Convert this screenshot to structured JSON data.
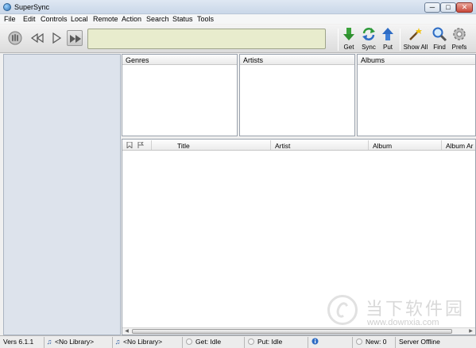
{
  "window": {
    "title": "SuperSync",
    "minimize_glyph": "─",
    "maximize_glyph": "□",
    "close_glyph": "✕"
  },
  "menu": [
    "File",
    "Edit",
    "Controls",
    "Local",
    "Remote",
    "Action",
    "Search",
    "Status",
    "Tools"
  ],
  "toolbar": {
    "get_label": "Get",
    "sync_label": "Sync",
    "put_label": "Put",
    "show_all_label": "Show All",
    "find_label": "Find",
    "prefs_label": "Prefs",
    "colors": {
      "get": "#3aa23a",
      "put": "#2e6cc4",
      "sync": "#2e9a3a",
      "display_bg": "#e8eccd"
    }
  },
  "browser": {
    "genres_header": "Genres",
    "artists_header": "Artists",
    "albums_header": "Albums"
  },
  "tracklist": {
    "columns": {
      "title": "Title",
      "artist": "Artist",
      "album": "Album",
      "album_artist": "Album Ar"
    },
    "scroll_left_glyph": "◀",
    "scroll_right_glyph": "▶"
  },
  "status": {
    "version": "Vers 6.1.1",
    "local_library": "<No Library>",
    "remote_library": "<No Library>",
    "get_status": "Get: Idle",
    "put_status": "Put: Idle",
    "new_count": "New: 0",
    "server": "Server Offline",
    "note_glyph": "♫"
  },
  "watermark": {
    "text": "当下软件园",
    "url": "www.downxia.com"
  }
}
